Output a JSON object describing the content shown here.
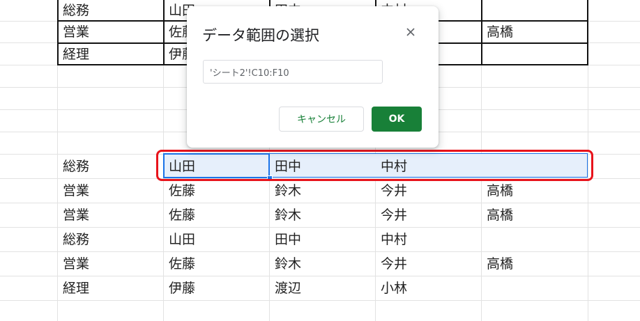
{
  "table_top": {
    "rows": [
      [
        "総務",
        "山田",
        "田中",
        "中村",
        ""
      ],
      [
        "営業",
        "佐藤",
        "",
        "",
        "高橋"
      ],
      [
        "経理",
        "伊藤",
        "",
        "",
        ""
      ]
    ]
  },
  "table_bottom": {
    "rows": [
      [
        "総務",
        "山田",
        "田中",
        "中村",
        ""
      ],
      [
        "営業",
        "佐藤",
        "鈴木",
        "今井",
        "高橋"
      ],
      [
        "営業",
        "佐藤",
        "鈴木",
        "今井",
        "高橋"
      ],
      [
        "総務",
        "山田",
        "田中",
        "中村",
        ""
      ],
      [
        "営業",
        "佐藤",
        "鈴木",
        "今井",
        "高橋"
      ],
      [
        "経理",
        "伊藤",
        "渡辺",
        "小林",
        ""
      ]
    ]
  },
  "dialog": {
    "title": "データ範囲の選択",
    "range_value": "'シート2'!C10:F10",
    "cancel_label": "キャンセル",
    "ok_label": "OK"
  },
  "colors": {
    "accent_green": "#188038",
    "selection_blue": "#1a73e8",
    "highlight_red": "#e8131b"
  }
}
